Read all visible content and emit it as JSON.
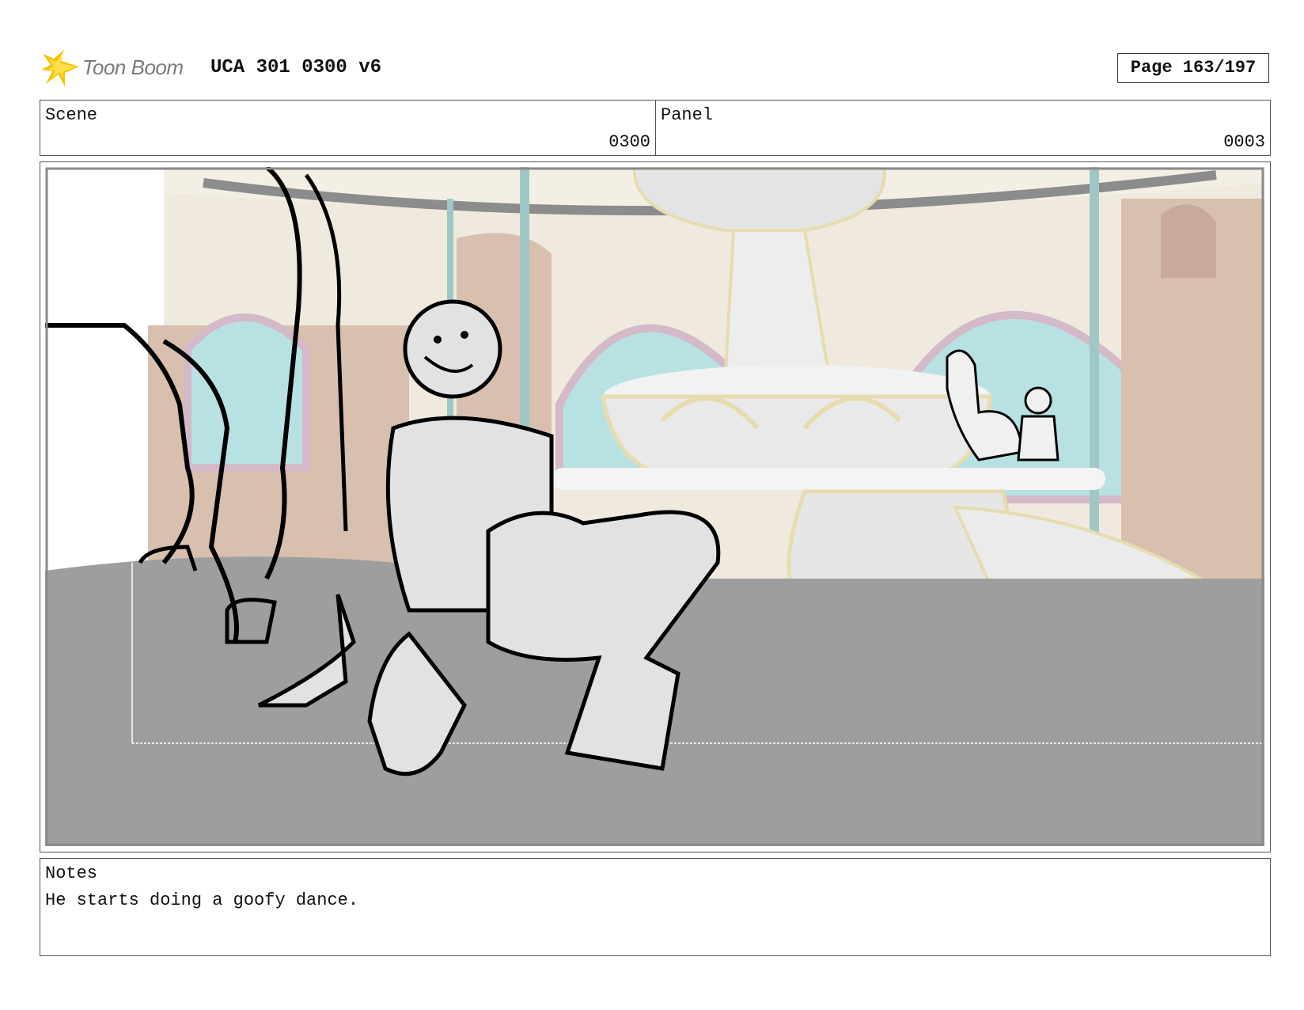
{
  "header": {
    "logo_text": "Toon Boom",
    "title": "UCA 301 0300 v6",
    "page": "Page 163/197"
  },
  "info": {
    "scene_label": "Scene",
    "scene_value": "0300",
    "panel_label": "Panel",
    "panel_value": "0003"
  },
  "notes": {
    "label": "Notes",
    "text": "He starts doing a goofy dance."
  },
  "colors": {
    "logo_yellow": "#f5c400",
    "floor_gray": "#9e9e9e",
    "wall_cream": "#efeadd",
    "window_cyan": "#b8e1e3",
    "door_tan": "#d9bfae",
    "trim_gold": "#e6dcae"
  }
}
